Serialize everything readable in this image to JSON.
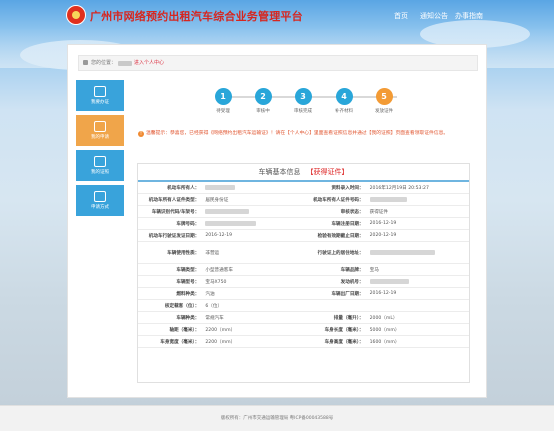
{
  "header": {
    "site_title": "广州市网络预约出租汽车综合业务管理平台",
    "nav": [
      "首页",
      "通知公告",
      "办事指南"
    ]
  },
  "breadcrumb": {
    "prefix": "您的位置：",
    "current": "进入个人中心"
  },
  "sidebar": [
    {
      "label": "我要办证",
      "icon": "document-icon",
      "active": false
    },
    {
      "label": "我的申请",
      "icon": "edit-icon",
      "active": true
    },
    {
      "label": "我的证照",
      "icon": "license-icon",
      "active": false
    },
    {
      "label": "申请方式",
      "icon": "list-icon",
      "active": false
    }
  ],
  "steps": [
    {
      "num": "1",
      "label": "待受理",
      "current": false
    },
    {
      "num": "2",
      "label": "审核中",
      "current": false
    },
    {
      "num": "3",
      "label": "审核完成",
      "current": false
    },
    {
      "num": "4",
      "label": "补齐材料",
      "current": false
    },
    {
      "num": "5",
      "label": "发放证件",
      "current": true
    }
  ],
  "notice": "温馨提示：恭喜您，已经获得《网络预约出租汽车运输证》！请在【个人中心】里面查看证照信息并通过【我的证照】页面查看领取证件信息。",
  "info": {
    "title": "车辆基本信息",
    "status": "【获得证件】",
    "rows": [
      {
        "k1": "机动车所有人：",
        "v1": "",
        "k2": "资料录入时间：",
        "v2": "2016年12月19日 20:53:27"
      },
      {
        "k1": "机动车所有人证件类型：",
        "v1": "居民身份证",
        "k2": "机动车所有人证件号码：",
        "v2": ""
      },
      {
        "k1": "车辆识别代码/车架号：",
        "v1": "",
        "k2": "审核状态：",
        "v2": "获得证件"
      },
      {
        "k1": "车牌号码：",
        "v1": "",
        "k2": "车辆注册日期：",
        "v2": "2016-12-19"
      },
      {
        "k1": "机动车行驶证发证日期：",
        "v1": "2016-12-19",
        "k2": "检验有效期截止日期：",
        "v2": "2020-12-19"
      },
      {
        "k1": "车辆使用性质：",
        "v1": "非营运",
        "k2": "行驶证上的居住地址：",
        "v2": ""
      },
      {
        "k1": "车辆类型：",
        "v1": "小型普通客车",
        "k2": "车辆品牌：",
        "v2": "宝马"
      },
      {
        "k1": "车辆型号：",
        "v1": "宝马X750",
        "k2": "发动机号：",
        "v2": ""
      },
      {
        "k1": "燃料种类：",
        "v1": "汽油",
        "k2": "车辆出厂日期：",
        "v2": "2016-12-19"
      },
      {
        "k1": "核定载客（位）：",
        "v1": "6（位）",
        "k2": "",
        "v2": ""
      },
      {
        "k1": "车辆种类：",
        "v1": "常规汽车",
        "k2": "排量（毫升）：",
        "v2": "2000（mL）"
      },
      {
        "k1": "轴距（毫米）：",
        "v1": "2200（mm）",
        "k2": "车身长度（毫米）：",
        "v2": "5000（mm）"
      },
      {
        "k1": "车身宽度（毫米）：",
        "v1": "2200（mm）",
        "k2": "车身高度（毫米）：",
        "v2": "1600（mm）"
      }
    ]
  },
  "footer": "版权所有：广州市交通运输管理局  粤ICP备00043588号"
}
